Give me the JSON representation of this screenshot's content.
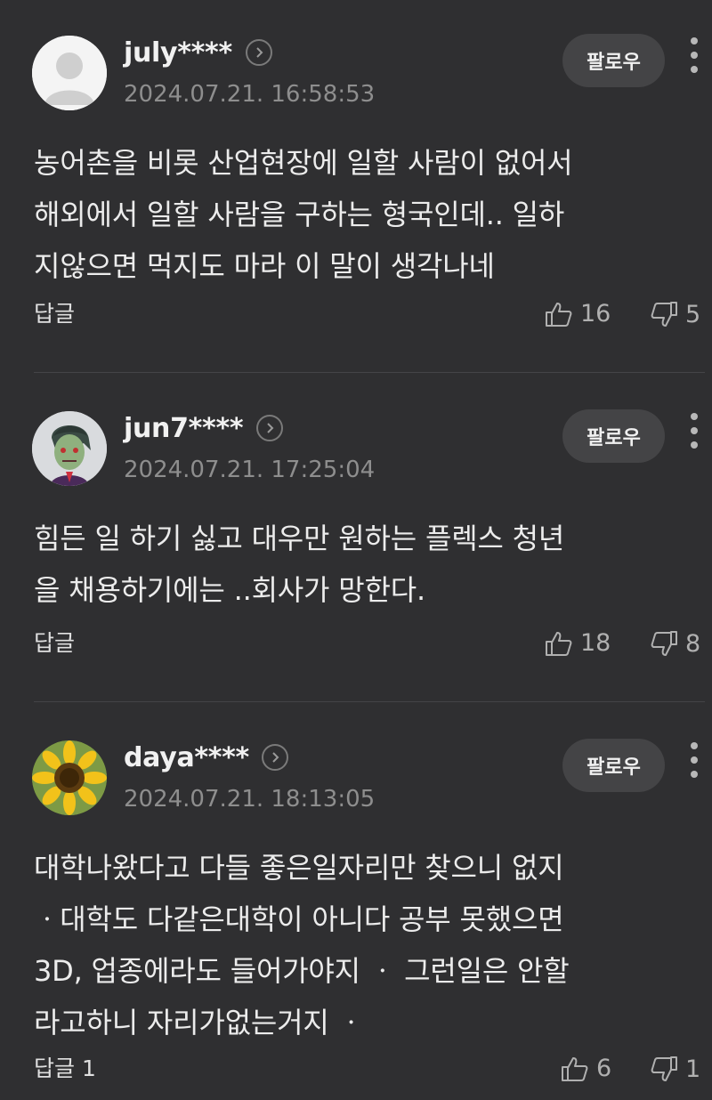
{
  "comments": [
    {
      "username": "july****",
      "timestamp": "2024.07.21. 16:58:53",
      "follow_label": "팔로우",
      "lines": [
        "농어촌을 비롯 산업현장에 일할 사람이 없어서",
        "해외에서 일할 사람을 구하는 형국인데.. 일하",
        "지않으면 먹지도 마라 이 말이 생각나네"
      ],
      "reply_label": "답글",
      "likes": "16",
      "dislikes": "5"
    },
    {
      "username": "jun7****",
      "timestamp": "2024.07.21. 17:25:04",
      "follow_label": "팔로우",
      "lines": [
        "힘든 일 하기 싫고 대우만 원하는 플렉스 청년",
        "을 채용하기에는 ..회사가 망한다."
      ],
      "reply_label": "답글",
      "likes": "18",
      "dislikes": "8"
    },
    {
      "username": "daya****",
      "timestamp": "2024.07.21. 18:13:05",
      "follow_label": "팔로우",
      "lines": [
        "대학나왔다고 다들 좋은일자리만 찾으니 없지",
        "ㆍ대학도 다같은대학이 아니다 공부 못했으면",
        "3D, 업종에라도 들어가야지 ㆍ 그런일은 안할",
        "라고하니 자리가없는거지 ㆍ"
      ],
      "reply_label": "답글 1",
      "likes": "6",
      "dislikes": "1"
    }
  ],
  "colors": {
    "background": "#2f2f31",
    "follow_button": "#444446",
    "timestamp": "#8e8e8e"
  },
  "icons": [
    "profile-arrow-icon",
    "more-icon",
    "thumbs-up-icon",
    "thumbs-down-icon"
  ]
}
